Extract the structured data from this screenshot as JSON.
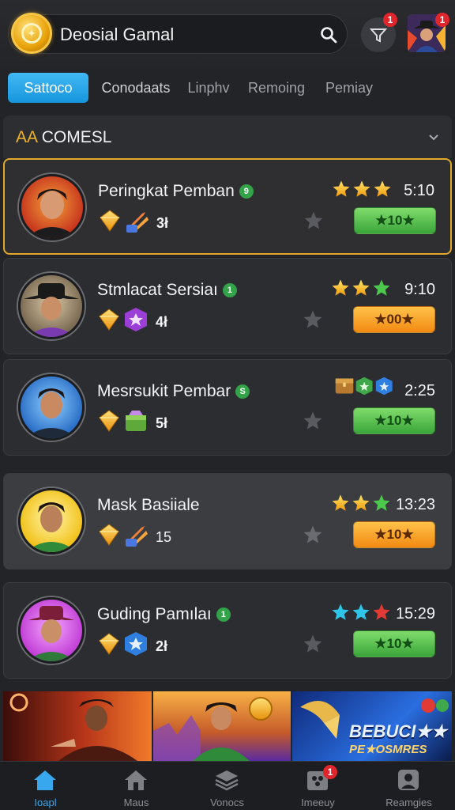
{
  "header": {
    "app_title": "Deosial Gamal",
    "notification_count": "1",
    "avatar_badge": "1"
  },
  "tabs": [
    {
      "label": "Sattoco",
      "active": true
    },
    {
      "label": "Conodaats",
      "active": false
    },
    {
      "label": "Linphv",
      "active": false
    },
    {
      "label": "Remoing",
      "active": false
    },
    {
      "label": "Pemiay",
      "active": false
    }
  ],
  "section": {
    "accent": "AA",
    "title": "COMESL"
  },
  "players": [
    {
      "name": "Peringkat Pemban",
      "level": "9",
      "count": "3ł",
      "time": "5:10",
      "reward": "★10★",
      "reward_color": "green",
      "rating_icons": [
        "gold-star",
        "gold-star",
        "gold-star"
      ],
      "item_icon": "arrows-icon"
    },
    {
      "name": "Stmlacat Sersiaı",
      "level": "1",
      "count": "4ł",
      "time": "9:10",
      "reward": "★00★",
      "reward_color": "orange",
      "rating_icons": [
        "gold-star",
        "gold-star",
        "green-star"
      ],
      "item_icon": "purple-box-icon"
    },
    {
      "name": "Mesrsukit Pembar",
      "level": "S",
      "count": "5ł",
      "time": "2:25",
      "reward": "★10★",
      "reward_color": "green",
      "rating_icons": [
        "chest",
        "green-box",
        "blue-box"
      ],
      "item_icon": "green-chest-icon"
    },
    {
      "name": "Mask Basiiale",
      "level": "",
      "count": "15",
      "time": "13:23",
      "reward": "★10★",
      "reward_color": "orange",
      "rating_icons": [
        "gold-star",
        "gold-star",
        "green-star"
      ],
      "item_icon": "arrows-icon"
    },
    {
      "name": "Guding Pamılaı",
      "level": "1",
      "count": "2ł",
      "time": "15:29",
      "reward": "★10★",
      "reward_color": "green",
      "rating_icons": [
        "cyan-star",
        "cyan-star",
        "red-star"
      ],
      "item_icon": "blue-box-icon"
    }
  ],
  "banners": {
    "promo_line1": "BEBUCI★★",
    "promo_line2": "PE★OSMRES"
  },
  "nav": [
    {
      "label": "Ioapl",
      "icon": "home-icon",
      "active": true
    },
    {
      "label": "Maus",
      "icon": "house-icon",
      "active": false
    },
    {
      "label": "Vonocs",
      "icon": "layers-icon",
      "active": false
    },
    {
      "label": "Imeeuy",
      "icon": "inventory-icon",
      "active": false,
      "badge": "1"
    },
    {
      "label": "Reamgies",
      "icon": "profile-icon",
      "active": false
    }
  ],
  "colors": {
    "accent_blue": "#1796dd",
    "gold": "#f0b429",
    "reward_green": "#3aa53a",
    "reward_orange": "#f28a12"
  }
}
